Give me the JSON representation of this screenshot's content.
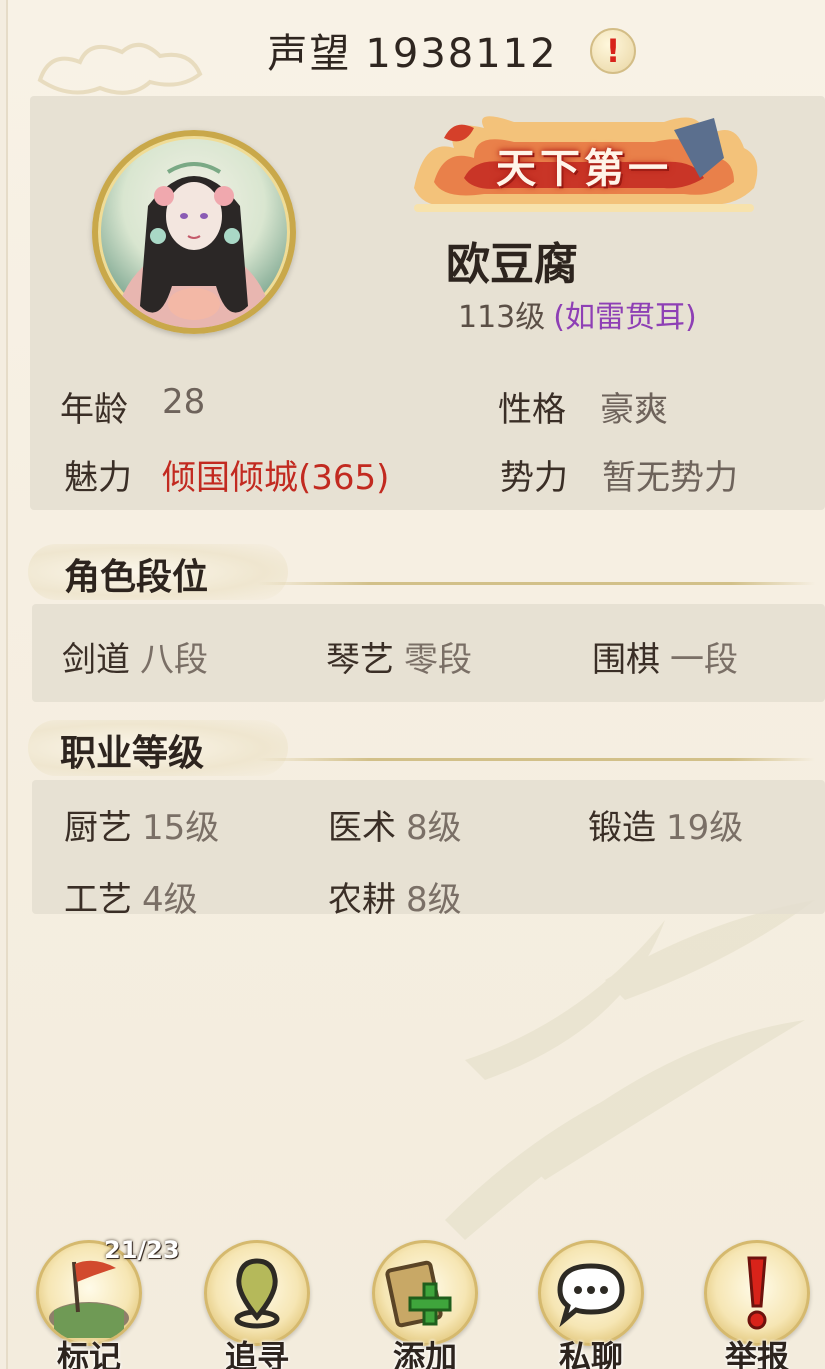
{
  "header": {
    "reputation_label": "声望",
    "reputation_value": "1938112",
    "warning_mark": "!"
  },
  "profile": {
    "title_badge": "天下第一",
    "name": "欧豆腐",
    "level": "113级",
    "fame": "(如雷贯耳)",
    "age_label": "年龄",
    "age_value": "28",
    "personality_label": "性格",
    "personality_value": "豪爽",
    "charm_label": "魅力",
    "charm_value": "倾国倾城(365)",
    "faction_label": "势力",
    "faction_value": "暂无势力"
  },
  "ranks": {
    "title": "角色段位",
    "items": [
      {
        "label": "剑道",
        "value": "八段"
      },
      {
        "label": "琴艺",
        "value": "零段"
      },
      {
        "label": "围棋",
        "value": "一段"
      }
    ]
  },
  "professions": {
    "title": "职业等级",
    "items": [
      {
        "label": "厨艺",
        "value": "15级"
      },
      {
        "label": "医术",
        "value": "8级"
      },
      {
        "label": "锻造",
        "value": "19级"
      },
      {
        "label": "工艺",
        "value": "4级"
      },
      {
        "label": "农耕",
        "value": "8级"
      }
    ]
  },
  "actions": {
    "mark_count": "21/23",
    "mark": "标记",
    "trace": "追寻",
    "add": "添加",
    "chat": "私聊",
    "report": "举报"
  },
  "colors": {
    "charm_red": "#c22a20",
    "fame_purple": "#8e3fb5",
    "panel_bg": "#e4ded0",
    "gold_ring": "#c9a84a"
  }
}
